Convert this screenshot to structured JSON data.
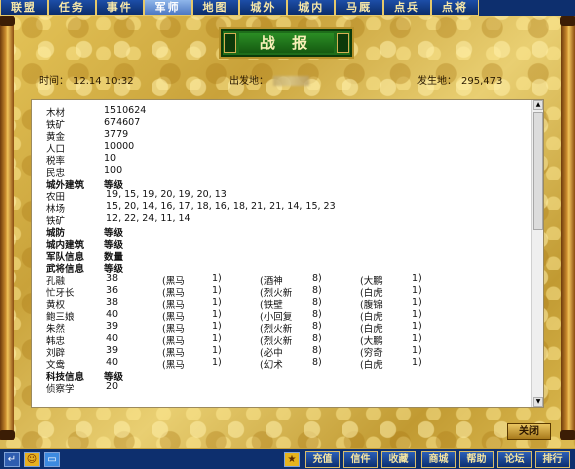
{
  "nav": {
    "tabs": [
      "联盟",
      "任务",
      "事件",
      "军师",
      "地图",
      "城外",
      "城内",
      "马厩",
      "点兵",
      "点将"
    ],
    "active": "军师"
  },
  "title": "战 报",
  "info": {
    "time_label": "时间：",
    "time_value": "12.14  10:32",
    "origin_label": "出发地：",
    "dest_label": "发生地：",
    "dest_value": "295,473"
  },
  "report": {
    "resources": [
      {
        "label": "木材",
        "value": "1510624"
      },
      {
        "label": "铁矿",
        "value": "674607"
      },
      {
        "label": "黄金",
        "value": "3779"
      },
      {
        "label": "人口",
        "value": "10000"
      },
      {
        "label": "税率",
        "value": "10"
      },
      {
        "label": "民忠",
        "value": "100"
      }
    ],
    "outer_buildings": {
      "header": "城外建筑",
      "header_value": "等级",
      "rows": [
        {
          "label": "农田",
          "value": "19, 15, 19, 20, 19, 20, 13"
        },
        {
          "label": "林场",
          "value": "15, 20, 14, 16, 17, 18, 16, 18, 21, 21, 14, 15, 23"
        },
        {
          "label": "铁矿",
          "value": "12, 22, 24, 11, 14"
        }
      ]
    },
    "defense": {
      "label": "城防",
      "value": "等级"
    },
    "inner_buildings": {
      "label": "城内建筑",
      "value": "等级"
    },
    "army": {
      "label": "军队信息",
      "value": "数量"
    },
    "generals": {
      "header": "武将信息",
      "header_value": "等级",
      "rows": [
        {
          "name": "孔融",
          "level": "38",
          "horse": "(黑马",
          "horse_n": "1)",
          "weapon": "(酒神",
          "weapon_n": "8)",
          "item": "(大鹏",
          "item_n": "1)"
        },
        {
          "name": "忙牙长",
          "level": "36",
          "horse": "(黑马",
          "horse_n": "1)",
          "weapon": "(烈火新",
          "weapon_n": "8)",
          "item": "(白虎",
          "item_n": "1)"
        },
        {
          "name": "黄权",
          "level": "38",
          "horse": "(黑马",
          "horse_n": "1)",
          "weapon": "(铁壁",
          "weapon_n": "8)",
          "item": "(腹锦",
          "item_n": "1)"
        },
        {
          "name": "鲍三娘",
          "level": "40",
          "horse": "(黑马",
          "horse_n": "1)",
          "weapon": "(小回复",
          "weapon_n": "8)",
          "item": "(白虎",
          "item_n": "1)"
        },
        {
          "name": "朱然",
          "level": "39",
          "horse": "(黑马",
          "horse_n": "1)",
          "weapon": "(烈火新",
          "weapon_n": "8)",
          "item": "(白虎",
          "item_n": "1)"
        },
        {
          "name": "韩忠",
          "level": "40",
          "horse": "(黑马",
          "horse_n": "1)",
          "weapon": "(烈火新",
          "weapon_n": "8)",
          "item": "(大鹏",
          "item_n": "1)"
        },
        {
          "name": "刘辟",
          "level": "39",
          "horse": "(黑马",
          "horse_n": "1)",
          "weapon": "(必中",
          "weapon_n": "8)",
          "item": "(穷奇",
          "item_n": "1)"
        },
        {
          "name": "文鸯",
          "level": "40",
          "horse": "(黑马",
          "horse_n": "1)",
          "weapon": "(幻术",
          "weapon_n": "8)",
          "item": "(白虎",
          "item_n": "1)"
        }
      ]
    },
    "tech": {
      "header": "科技信息",
      "header_value": "等级",
      "rows": [
        {
          "label": "侦察学",
          "value": "20"
        }
      ]
    }
  },
  "close_label": "关闭",
  "bottom": {
    "buttons": [
      "充值",
      "信件",
      "收藏",
      "商城",
      "帮助",
      "论坛",
      "排行"
    ]
  },
  "icons": {
    "bottom_left": [
      "return-icon",
      "smiley-icon",
      "screen-icon"
    ],
    "bottom_star": "star-icon"
  },
  "colors": {
    "nav_bg": "#0d2f6e",
    "title_bg": "#1e6d1a",
    "gold": "#d9b54a"
  }
}
